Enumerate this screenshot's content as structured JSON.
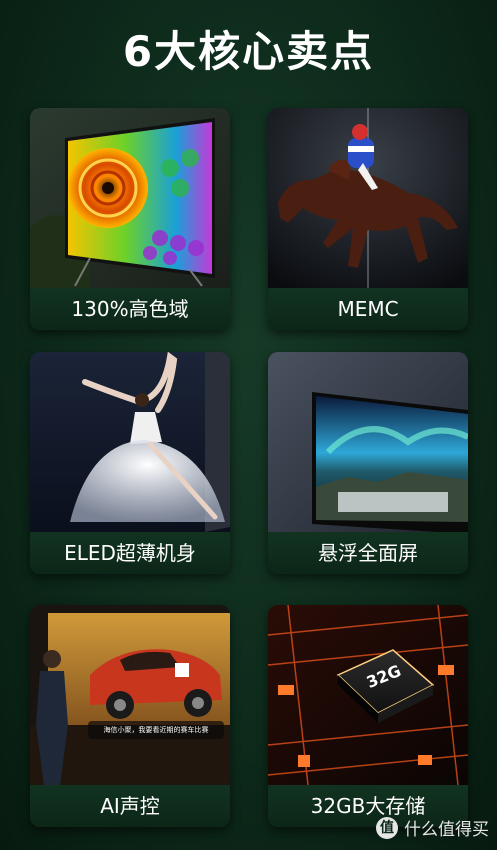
{
  "title": "6大核心卖点",
  "cards": [
    {
      "caption": "130%高色域",
      "icon": "chameleon-tv-image"
    },
    {
      "caption": "MEMC",
      "icon": "racehorse-image"
    },
    {
      "caption": "ELED超薄机身",
      "icon": "ballerina-image"
    },
    {
      "caption": "悬浮全面屏",
      "icon": "aurora-tv-image"
    },
    {
      "caption": "AI声控",
      "icon": "rally-car-image"
    },
    {
      "caption": "32GB大存储",
      "icon": "chip-image"
    }
  ],
  "voice_bubble": "海信小聚，我要看近期的赛车比赛",
  "chip_label": "32G",
  "watermark": {
    "site": "什么值得买",
    "logo_char": "值"
  }
}
